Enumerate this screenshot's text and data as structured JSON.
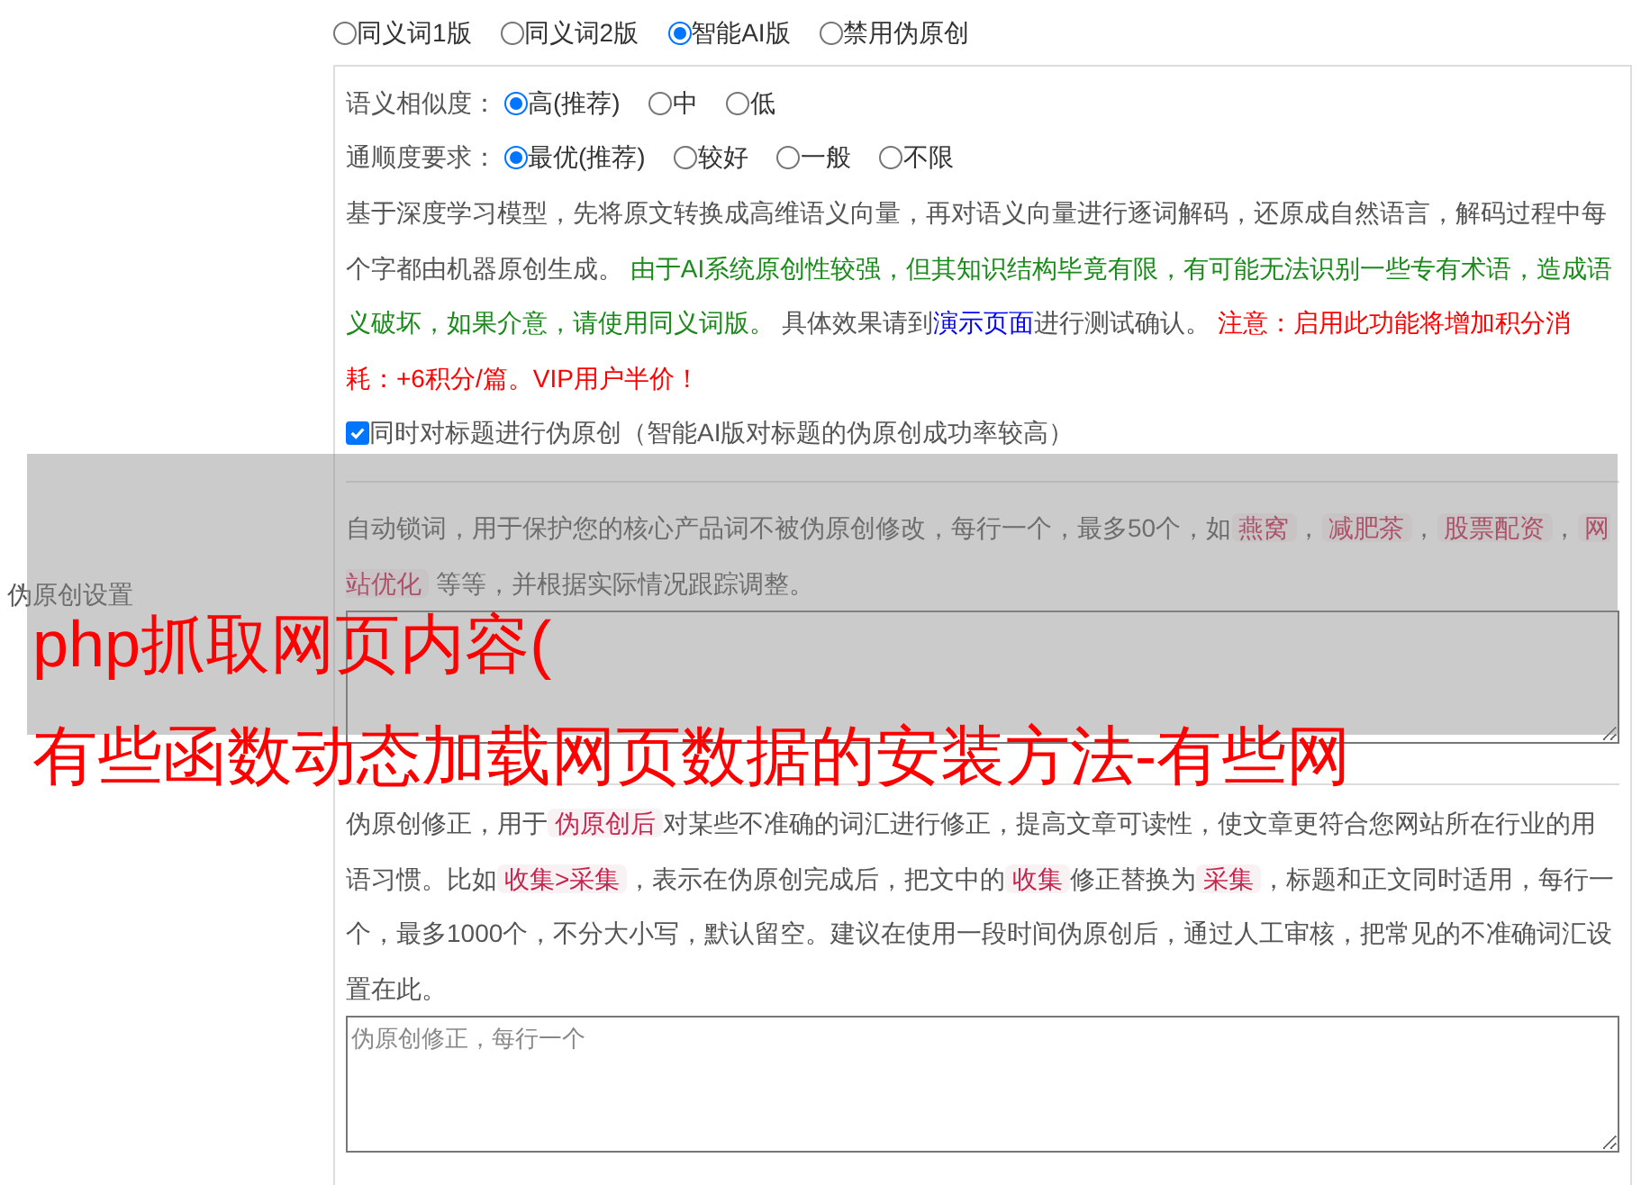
{
  "mode_options": [
    {
      "label": "同义词1版",
      "selected": false
    },
    {
      "label": "同义词2版",
      "selected": false
    },
    {
      "label": "智能AI版",
      "selected": true
    },
    {
      "label": "禁用伪原创",
      "selected": false
    }
  ],
  "similarity": {
    "label": "语义相似度：",
    "options": [
      {
        "label": "高(推荐)",
        "selected": true
      },
      {
        "label": "中",
        "selected": false
      },
      {
        "label": "低",
        "selected": false
      }
    ]
  },
  "fluency": {
    "label": "通顺度要求：",
    "options": [
      {
        "label": "最优(推荐)",
        "selected": true
      },
      {
        "label": "较好",
        "selected": false
      },
      {
        "label": "一般",
        "selected": false
      },
      {
        "label": "不限",
        "selected": false
      }
    ]
  },
  "ai_description": [
    {
      "kind": "text",
      "text": "基于深度学习模型，先将原文转换成高维语义向量，再对语义向量进行逐词解码，还原成自然语言，解码过程中每个字都由机器原创生成。 "
    },
    {
      "kind": "green",
      "text": "由于AI系统原创性较强，但其知识结构毕竟有限，有可能无法识别一些专有术语，造成语义破坏，如果介意，请使用同义词版。"
    },
    {
      "kind": "text",
      "text": " 具体效果请到"
    },
    {
      "kind": "link",
      "text": "演示页面"
    },
    {
      "kind": "text",
      "text": "进行测试确认。 "
    },
    {
      "kind": "red",
      "text": "注意：启用此功能将增加积分消耗：+6积分/篇。VIP用户半价！"
    }
  ],
  "title_option": {
    "label": "同时对标题进行伪原创（智能AI版对标题的伪原创成功率较高）",
    "checked": true
  },
  "section_label": "伪原创设置",
  "lock_words": {
    "description": [
      {
        "kind": "text",
        "text": "自动锁词，用于保护您的核心产品词不被伪原创修改，每行一个，最多50个，如"
      },
      {
        "kind": "code",
        "text": "燕窝"
      },
      {
        "kind": "text",
        "text": "，"
      },
      {
        "kind": "code",
        "text": "减肥茶"
      },
      {
        "kind": "text",
        "text": "，"
      },
      {
        "kind": "code",
        "text": "股票配资"
      },
      {
        "kind": "text",
        "text": "，"
      },
      {
        "kind": "code",
        "text": "网站优化"
      },
      {
        "kind": "text",
        "text": " 等等，并根据实际情况跟踪调整。"
      }
    ]
  },
  "corrections": {
    "description": [
      {
        "kind": "text",
        "text": "伪原创修正，用于"
      },
      {
        "kind": "code",
        "text": "伪原创后"
      },
      {
        "kind": "text",
        "text": "对某些不准确的词汇进行修正，提高文章可读性，使文章更符合您网站所在行业的用语习惯。比如"
      },
      {
        "kind": "code",
        "text": "收集>采集"
      },
      {
        "kind": "text",
        "text": "，表示在伪原创完成后，把文中的"
      },
      {
        "kind": "code",
        "text": "收集"
      },
      {
        "kind": "text",
        "text": "修正替换为"
      },
      {
        "kind": "code",
        "text": "采集"
      },
      {
        "kind": "text",
        "text": "，标题和正文同时适用，每行一个，最多1000个，不分大小写，默认留空。建议在使用一段时间伪原创后，通过人工审核，把常见的不准确词汇设置在此。"
      }
    ],
    "placeholder": "伪原创修正，每行一个"
  },
  "overlay_title": {
    "lines": [
      "php抓取网页内容(",
      "有些函数动态加载网页数据的安装方法-有些网"
    ]
  }
}
